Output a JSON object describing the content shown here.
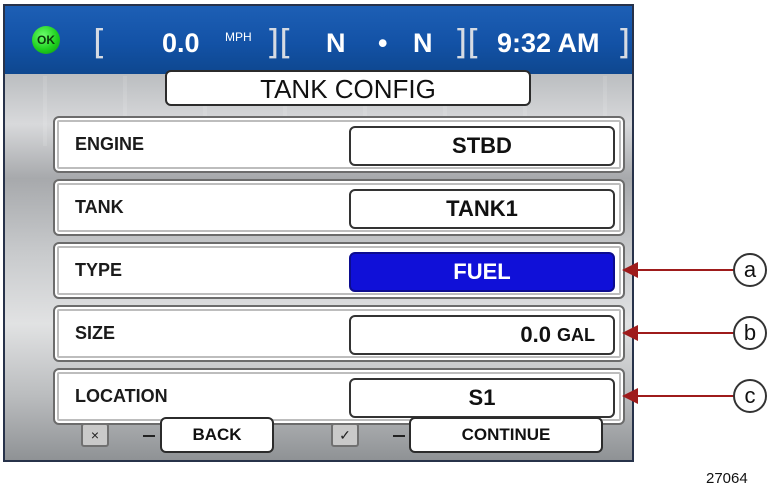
{
  "status": {
    "ok_label": "OK",
    "speed_value": "0.0",
    "speed_unit": "MPH",
    "gear_left": "N",
    "gear_sep": "•",
    "gear_right": "N",
    "time": "9:32 AM"
  },
  "screen_title": "TANK CONFIG",
  "rows": [
    {
      "label": "ENGINE",
      "value": "STBD"
    },
    {
      "label": "TANK",
      "value": "TANK1"
    },
    {
      "label": "TYPE",
      "value": "FUEL"
    },
    {
      "label": "SIZE",
      "value": "0.0",
      "unit": "GAL"
    },
    {
      "label": "LOCATION",
      "value": "S1"
    }
  ],
  "buttons": {
    "back_icon": "×",
    "back_label": "BACK",
    "continue_icon": "✓",
    "continue_label": "CONTINUE"
  },
  "callouts": [
    "a",
    "b",
    "c"
  ],
  "figure_number": "27064",
  "colors": {
    "statusbar": "#1352a6",
    "selected": "#1010d8",
    "callout": "#9e1b1b",
    "ok": "#1fd11f"
  }
}
